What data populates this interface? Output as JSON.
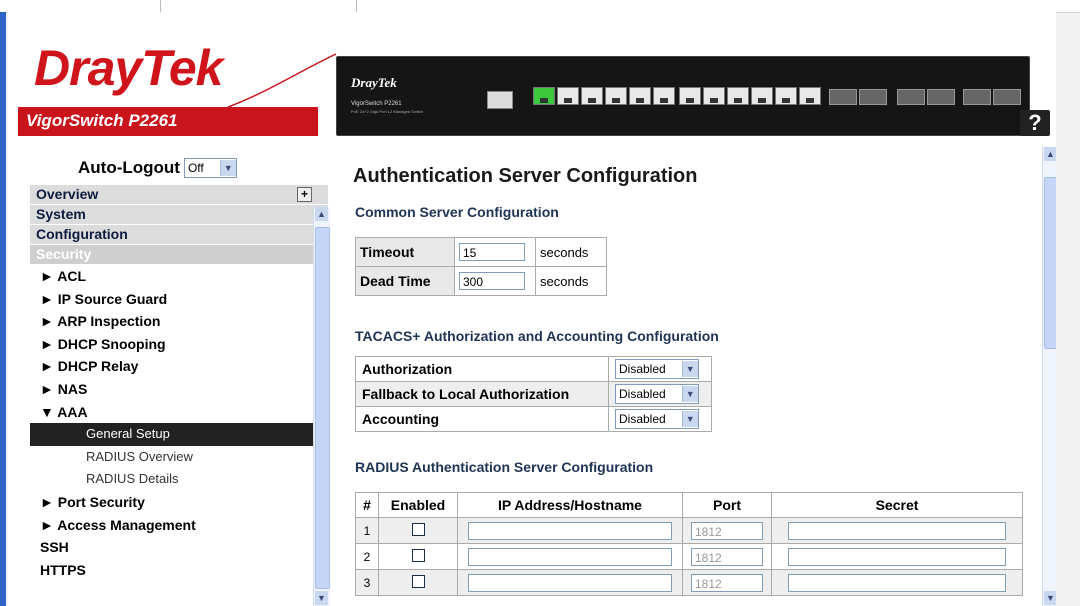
{
  "header": {
    "logo": "DrayTek",
    "model": "VigorSwitch P2261",
    "panel_brand": "DrayTek",
    "panel_model": "VigorSwitch P2261",
    "panel_sub": "PoE 24+2 Giga Port L2 Managed Switch",
    "help_label": "?",
    "help_icon": "help-icon"
  },
  "sidebar": {
    "auto_logout_label": "Auto-Logout",
    "auto_logout_value": "Off",
    "tabs": [
      {
        "label": "Overview"
      },
      {
        "label": "System"
      },
      {
        "label": "Configuration"
      },
      {
        "label": "Security"
      }
    ],
    "items": [
      {
        "label": "► ACL"
      },
      {
        "label": "► IP Source Guard"
      },
      {
        "label": "► ARP Inspection"
      },
      {
        "label": "► DHCP Snooping"
      },
      {
        "label": "► DHCP Relay"
      },
      {
        "label": "► NAS"
      },
      {
        "label": "▼ AAA"
      }
    ],
    "aaa_sub": [
      {
        "label": "General Setup"
      },
      {
        "label": "RADIUS Overview"
      },
      {
        "label": "RADIUS Details"
      }
    ],
    "items2": [
      {
        "label": "► Port Security"
      },
      {
        "label": "► Access Management"
      },
      {
        "label": "SSH"
      },
      {
        "label": "HTTPS"
      }
    ]
  },
  "content": {
    "title": "Authentication Server Configuration",
    "common_heading": "Common Server Configuration",
    "timeout_label": "Timeout",
    "timeout_value": "15",
    "timeout_unit": "seconds",
    "dead_label": "Dead Time",
    "dead_value": "300",
    "dead_unit": "seconds",
    "tacacs_heading": "TACACS+ Authorization and Accounting Configuration",
    "authz_label": "Authorization",
    "authz_value": "Disabled",
    "fallback_label": "Fallback to Local Authorization",
    "fallback_value": "Disabled",
    "acct_label": "Accounting",
    "acct_value": "Disabled",
    "radius_heading": "RADIUS Authentication Server Configuration",
    "radius_columns": [
      "#",
      "Enabled",
      "IP Address/Hostname",
      "Port",
      "Secret"
    ],
    "radius_rows": [
      {
        "num": "1",
        "port": "1812"
      },
      {
        "num": "2",
        "port": "1812"
      },
      {
        "num": "3",
        "port": "1812"
      }
    ]
  },
  "colors": {
    "brand_red": "#c8141a",
    "menu_blue": "#c4d5f5"
  }
}
